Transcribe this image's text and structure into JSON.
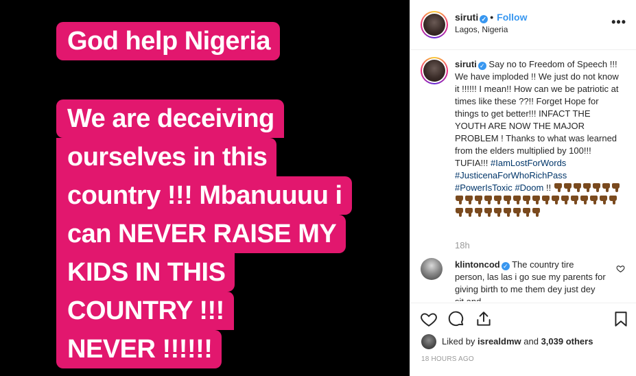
{
  "media": {
    "lines": [
      "God help Nigeria",
      "We are deceiving",
      "ourselves in this",
      "country !!! Mbanuuuu i",
      "can NEVER RAISE MY",
      "KIDS IN THIS",
      "COUNTRY !!!",
      "NEVER !!!!!!"
    ],
    "highlight_color": "#e2176e"
  },
  "post_header": {
    "username": "siruti",
    "dot": "•",
    "follow_label": "Follow",
    "location": "Lagos, Nigeria",
    "more_icon": "more-options-icon",
    "more_label": "•••"
  },
  "caption": {
    "username": "siruti",
    "text": "Say no to Freedom of Speech !!! We have imploded !! We just do not know it !!!!!! I mean!! How can we be patriotic at times like these ??!! Forget Hope for things to get better!!! INFACT THE YOUTH ARE NOW THE MAJOR PROBLEM ! Thanks to what was learned from the elders multiplied by 100!!! TUFIA!!! ",
    "hashtags": [
      "#IamLostForWords",
      "#JusticenaForWhoRichPass",
      "#PowerIsToxic",
      "#Doom"
    ],
    "after_tags": " !! ",
    "thumbs_down_count": 33,
    "time": "18h"
  },
  "comment": {
    "username": "klintoncod",
    "text": "The country tire person, las las i go sue my parents for giving birth to me them dey just dey sit and"
  },
  "actions": {
    "like_icon": "heart-icon",
    "comment_icon": "comment-icon",
    "share_icon": "share-icon",
    "save_icon": "bookmark-icon"
  },
  "likes": {
    "prefix": "Liked by ",
    "user": "isrealdmw",
    "mid": " and ",
    "count": "3,039 others"
  },
  "timestamp": "18 HOURS AGO",
  "colors": {
    "link_blue": "#3897f0",
    "hashtag": "#003569",
    "muted": "#999999"
  }
}
